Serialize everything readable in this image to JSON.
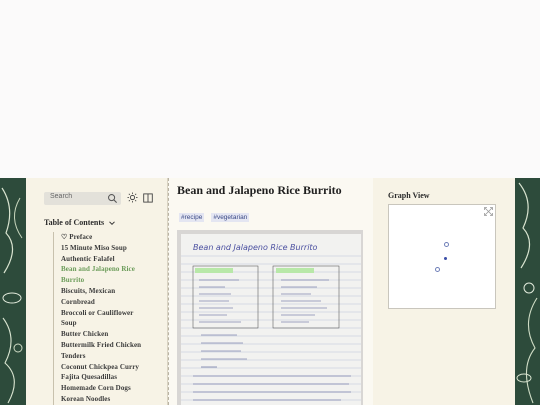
{
  "search": {
    "placeholder": "Search"
  },
  "icons": {
    "search": "search-icon",
    "theme": "sun-icon",
    "reader": "book-icon",
    "toc_toggle": "chevron-down-icon",
    "expand": "expand-icon"
  },
  "toc": {
    "title": "Table of Contents",
    "items": [
      {
        "label": "♡ Preface"
      },
      {
        "label": "15 Minute Miso Soup"
      },
      {
        "label": "Authentic Falafel"
      },
      {
        "label": "Bean and Jalapeno Rice"
      },
      {
        "label": "Burrito"
      },
      {
        "label": "Biscuits, Mexican"
      },
      {
        "label": "Cornbread"
      },
      {
        "label": "Broccoli or Cauliflower"
      },
      {
        "label": "Soup"
      },
      {
        "label": "Butter Chicken"
      },
      {
        "label": "Buttermilk Fried Chicken"
      },
      {
        "label": "Tenders"
      },
      {
        "label": "Coconut Chickpea Curry"
      },
      {
        "label": "Fajita Quesadillas"
      },
      {
        "label": "Homemade Corn Dogs"
      },
      {
        "label": "Korean Noodles"
      }
    ],
    "active_label": "Bean and Jalapeno Rice Burrito"
  },
  "page": {
    "title": "Bean and Jalapeno Rice Burrito",
    "tags": [
      "#recipe",
      "#vegetarian"
    ],
    "note_title": "Bean and Jalapeno Rice Burrito"
  },
  "graph": {
    "title": "Graph View",
    "nodes": [
      {
        "accent": false
      },
      {
        "accent": true
      },
      {
        "accent": false
      }
    ]
  },
  "colors": {
    "accent": "#6a9b58",
    "tag_text": "#3b4a86",
    "node_current": "#3b4fa8"
  }
}
